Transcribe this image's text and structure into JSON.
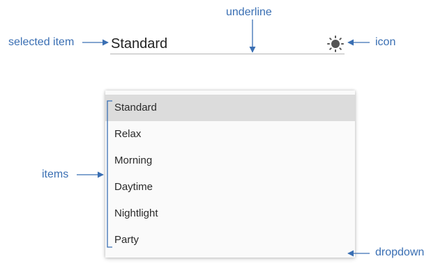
{
  "callouts": {
    "underline": "underline",
    "selected_item": "selected item",
    "icon": "icon",
    "items": "items",
    "dropdown": "dropdown"
  },
  "selector": {
    "selected_value": "Standard",
    "icon": "sun-icon"
  },
  "dropdown": {
    "items": [
      {
        "label": "Standard",
        "selected": true
      },
      {
        "label": "Relax",
        "selected": false
      },
      {
        "label": "Morning",
        "selected": false
      },
      {
        "label": "Daytime",
        "selected": false
      },
      {
        "label": "Nightlight",
        "selected": false
      },
      {
        "label": "Party",
        "selected": false
      }
    ]
  },
  "colors": {
    "callout": "#3a6fb3",
    "selected_item_background": "#dcdcdc",
    "underline": "#b5b5b5",
    "icon": "#555555"
  }
}
